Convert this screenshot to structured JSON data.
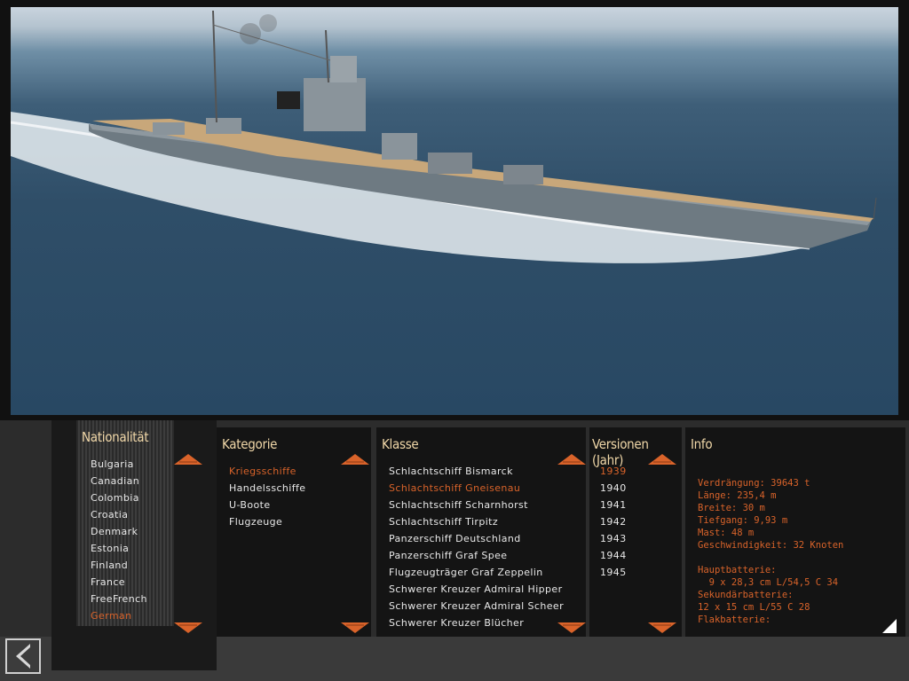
{
  "scene": {
    "subject": "battleship-3d-view"
  },
  "nationality": {
    "title": "Nationalität",
    "items": [
      "Bulgaria",
      "Canadian",
      "Colombia",
      "Croatia",
      "Denmark",
      "Estonia",
      "Finland",
      "France",
      "FreeFrench",
      "German"
    ],
    "selected": "German"
  },
  "category": {
    "title": "Kategorie",
    "items": [
      "Kriegsschiffe",
      "Handelsschiffe",
      "U-Boote",
      "Flugzeuge"
    ],
    "selected": "Kriegsschiffe"
  },
  "class": {
    "title": "Klasse",
    "items": [
      "Schlachtschiff Bismarck",
      "Schlachtschiff Gneisenau",
      "Schlachtschiff Scharnhorst",
      "Schlachtschiff Tirpitz",
      "Panzerschiff Deutschland",
      "Panzerschiff Graf Spee",
      "Flugzeugträger Graf Zeppelin",
      "Schwerer Kreuzer Admiral Hipper",
      "Schwerer Kreuzer Admiral Scheer",
      "Schwerer Kreuzer Blücher"
    ],
    "selected": "Schlachtschiff Gneisenau"
  },
  "versions": {
    "title": "Versionen (Jahr)",
    "items": [
      "1939",
      "1940",
      "1941",
      "1942",
      "1943",
      "1944",
      "1945"
    ],
    "selected": "1939"
  },
  "info": {
    "title": "Info",
    "text": "Verdrängung: 39643 t\nLänge: 235,4 m\nBreite: 30 m\nTiefgang: 9,93 m\nMast: 48 m\nGeschwindigkeit: 32 Knoten\n\nHauptbatterie:\n  9 x 28,3 cm L/54,5 C 34\nSekundärbatterie:\n12 x 15 cm L/55 C 28\nFlakbatterie:"
  },
  "colors": {
    "accent": "#d9632a",
    "title": "#f0d7a8",
    "text": "#e8e8e8",
    "panel": "#141414"
  },
  "icons": {
    "scroll_up": "arrow-up-icon",
    "scroll_down": "arrow-down-icon",
    "back": "back-arrow-icon",
    "resize": "resize-corner-icon"
  }
}
